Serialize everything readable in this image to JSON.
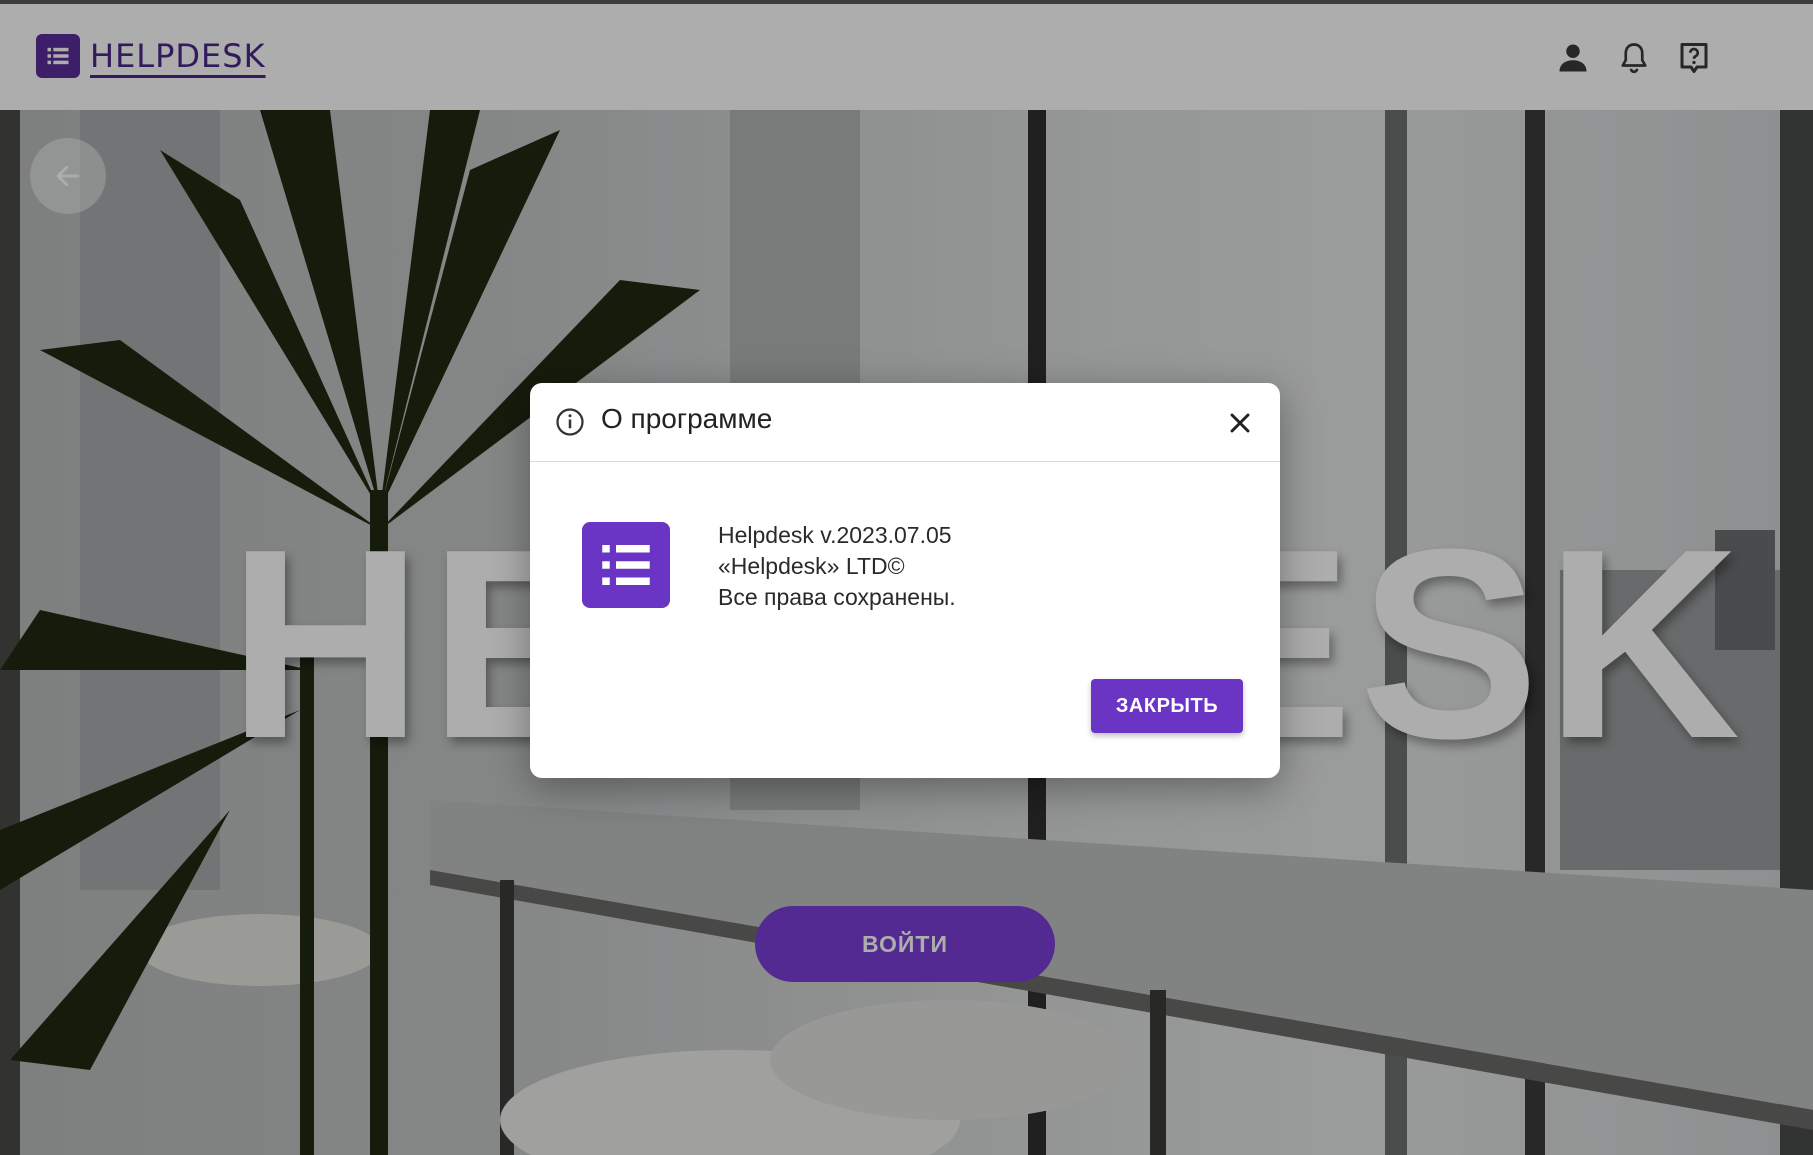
{
  "header": {
    "logo_text": "HELPDESK",
    "icons": [
      "user-icon",
      "bell-icon",
      "help-icon"
    ]
  },
  "hero": {
    "title": "HELPDESK",
    "login_label": "ВОЙТИ"
  },
  "dialog": {
    "title": "О программе",
    "lines": [
      "Helpdesk v.2023.07.05",
      "«Helpdesk» LTD©",
      "Все права сохранены."
    ],
    "close_label": "ЗАКРЫТЬ"
  },
  "colors": {
    "brand": "#6a35c4",
    "brand_dark": "#4a2888",
    "overlay": "rgba(0,0,0,0.32)"
  }
}
